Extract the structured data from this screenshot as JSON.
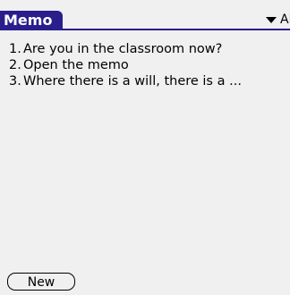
{
  "app": {
    "title": "Memo",
    "category": "All"
  },
  "memos": [
    {
      "number": "1.",
      "text": "Are  you in the classroom now?"
    },
    {
      "number": "2.",
      "text": "Open the memo"
    },
    {
      "number": "3.",
      "text": "Where there is a will, there is a ..."
    }
  ],
  "footer": {
    "new_label": "New"
  },
  "colors": {
    "title_bar": "#2a1d8c",
    "background": "#f0f0f0"
  }
}
